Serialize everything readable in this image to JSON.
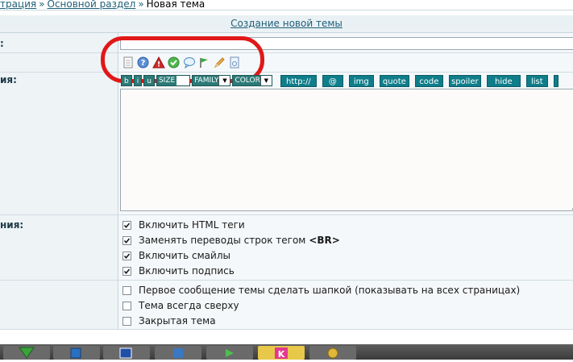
{
  "breadcrumb": {
    "item1": "трация",
    "sep1": "»",
    "item2": "Основной раздел",
    "sep2": "»",
    "current": "Новая тема"
  },
  "form_header": {
    "title": "Создание новой темы"
  },
  "labels": {
    "title": ":",
    "message": "ия:",
    "options": "ния:"
  },
  "post_icons": [
    "page-icon",
    "help-icon",
    "warning-icon",
    "check-icon",
    "speech-bubble-icon",
    "flag-icon",
    "pencil-icon",
    "document-icon"
  ],
  "toolbar": {
    "small_buttons": [
      "b",
      "i",
      "u"
    ],
    "size_label": "SIZE",
    "family_label": "FAMILY",
    "color_label": "COLOR",
    "buttons": [
      "http://",
      "@",
      "img",
      "quote",
      "code",
      "spoiler",
      "hide",
      "list",
      ""
    ]
  },
  "options_group1": [
    {
      "label": "Включить HTML теги",
      "suffix": "",
      "checked": true
    },
    {
      "label": "Заменять переводы строк тегом",
      "suffix": "<BR>",
      "checked": true
    },
    {
      "label": "Включить смайлы",
      "suffix": "",
      "checked": true
    },
    {
      "label": "Включить подпись",
      "suffix": "",
      "checked": true
    }
  ],
  "options_group2": [
    {
      "label": "Первое сообщение темы сделать шапкой (показывать на всех страницах)",
      "checked": false
    },
    {
      "label": "Тема всегда сверху",
      "checked": false
    },
    {
      "label": "Закрытая тема",
      "checked": false
    }
  ],
  "colors": {
    "accent": "#0f7d8a",
    "link": "#1f5f78",
    "highlight": "#e01818"
  },
  "taskbar": {
    "items": [
      "app-icon-1",
      "app-icon-2",
      "app-icon-3",
      "app-icon-4",
      "app-icon-5",
      "app-icon-6",
      "app-icon-7"
    ]
  }
}
